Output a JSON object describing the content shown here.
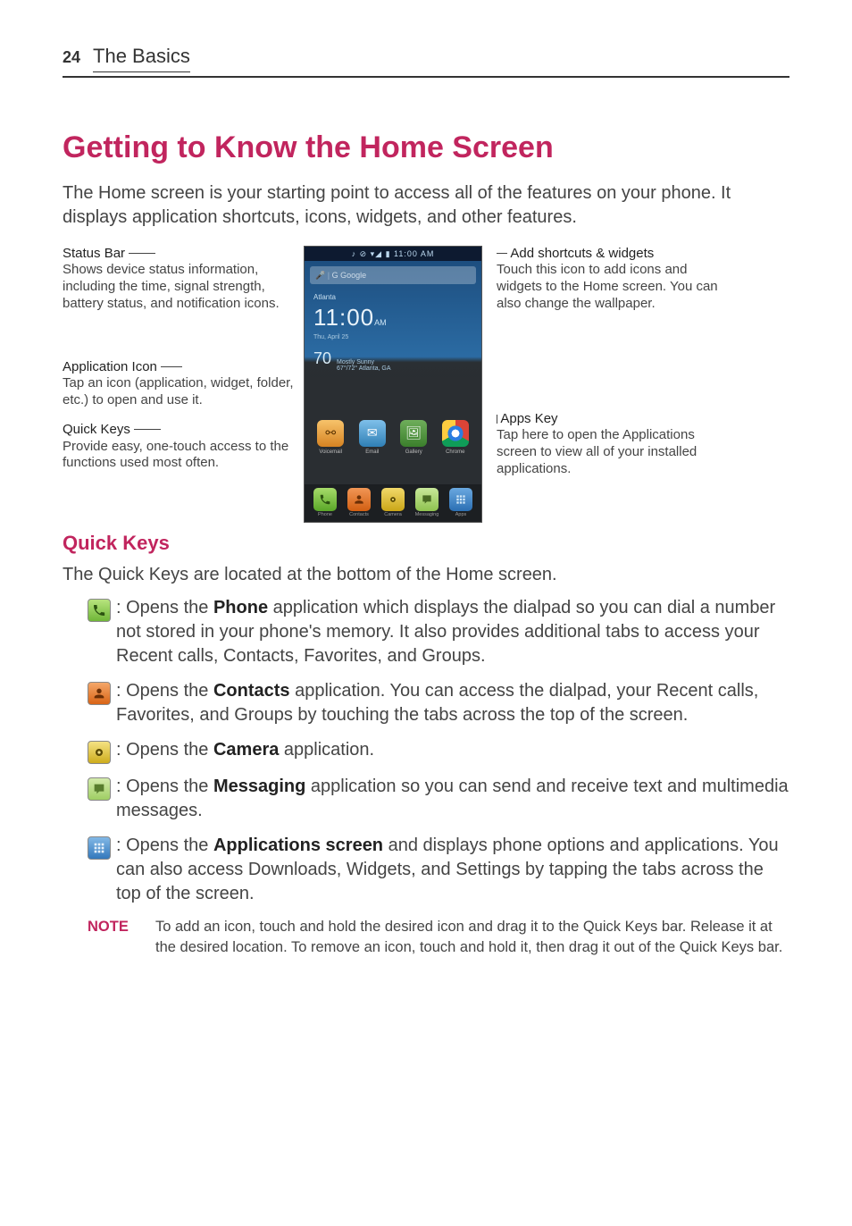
{
  "page_number": "24",
  "section": "The Basics",
  "title": "Getting to Know the Home Screen",
  "intro": "The Home screen is your starting point to access all of the features on your phone. It displays application shortcuts, icons, widgets, and other features.",
  "callouts": {
    "status_bar": {
      "title": "Status Bar",
      "desc": "Shows device status information, including the time, signal strength, battery status, and notification icons."
    },
    "app_icon": {
      "title": "Application Icon",
      "desc": "Tap an icon (application, widget, folder, etc.) to open and use it."
    },
    "quick_keys": {
      "title": "Quick Keys",
      "desc": "Provide easy, one-touch access to the functions used most often."
    },
    "add_shortcuts": {
      "title": "Add shortcuts & widgets",
      "desc": "Touch this icon to add icons and widgets to the Home screen. You can also change the wallpaper."
    },
    "apps_key": {
      "title": "Apps Key",
      "desc": "Tap here to open the Applications screen to view all of your installed applications."
    }
  },
  "phone": {
    "status_icons": "♪ ⊘ ▾◢ ▮ 11:00 AM",
    "search_hint": "⋮ G Google",
    "clock": {
      "city": "Atlanta",
      "time": "11:00",
      "date": "Thu, April 25",
      "am": "AM"
    },
    "weather": {
      "temp": "70",
      "line1": "Mostly Sunny",
      "line2": "67°/72°  Atlanta, GA"
    },
    "apps": [
      {
        "label": "Voicemail"
      },
      {
        "label": "Email"
      },
      {
        "label": "Gallery"
      },
      {
        "label": "Chrome"
      }
    ],
    "dock": [
      {
        "label": "Phone"
      },
      {
        "label": "Contacts"
      },
      {
        "label": "Camera"
      },
      {
        "label": "Messaging"
      },
      {
        "label": "Apps"
      }
    ]
  },
  "quick_keys_heading": "Quick Keys",
  "quick_keys_intro": "The Quick Keys are located at the bottom of the Home screen.",
  "qk_items": {
    "phone": {
      "pre": ": Opens the ",
      "bold": "Phone",
      "post": " application which displays the dialpad so you can dial a number not stored in your phone's memory. It also provides additional tabs to access your Recent calls, Contacts, Favorites, and Groups."
    },
    "contacts": {
      "pre": ": Opens the ",
      "bold": "Contacts",
      "post": " application. You can access the dialpad, your Recent calls, Favorites, and Groups by touching the tabs across the top of the screen."
    },
    "camera": {
      "pre": ": Opens the ",
      "bold": "Camera",
      "post": " application."
    },
    "messaging": {
      "pre": ": Opens the ",
      "bold": "Messaging",
      "post": " application so you can send and receive text and multimedia messages."
    },
    "apps": {
      "pre": ": Opens the ",
      "bold": "Applications screen",
      "post": " and displays phone options and applications. You can also access Downloads, Widgets, and Settings by tapping the tabs across the top of the screen."
    }
  },
  "note": {
    "label": "NOTE",
    "text": "To add an icon, touch and hold the desired icon and drag it to the Quick Keys bar. Release it at the desired location. To remove an icon, touch and hold it, then drag it out of the Quick Keys bar."
  }
}
